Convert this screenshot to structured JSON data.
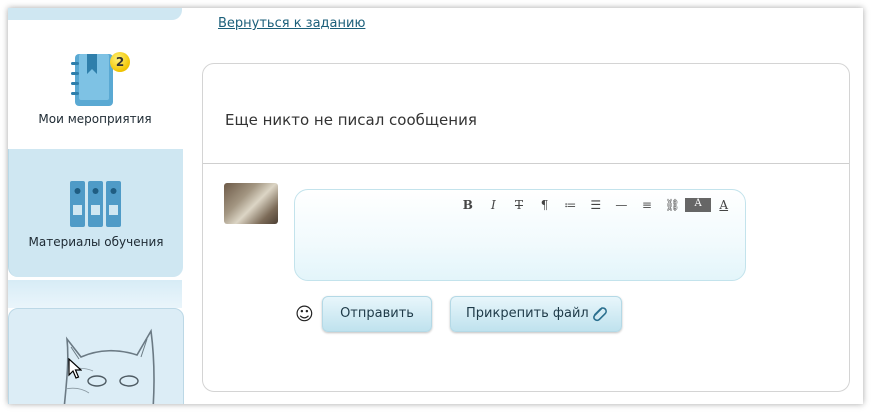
{
  "sidebar": {
    "items": [
      {
        "label": "Мои мероприятия",
        "icon": "bookmark-book-icon",
        "badge": "2",
        "active": true
      },
      {
        "label": "Материалы обучения",
        "icon": "binders-icon",
        "active": false
      }
    ],
    "tile_icon": "cat-sketch-image"
  },
  "content": {
    "back_link": "Вернуться к заданию",
    "empty_message": "Еще никто не писал сообщения",
    "toolbar": [
      "B",
      "I",
      "T",
      "¶",
      "≔",
      "☰",
      "—",
      "≡",
      "⛓",
      "A",
      "A"
    ],
    "send_label": "Отправить",
    "attach_label": "Прикрепить файл",
    "emoji_icon": "☺"
  },
  "colors": {
    "accent": "#1b5f7a",
    "sidebar_bg": "#cfe7f2",
    "button_bg": "#bfe2ee",
    "icon_blue": "#5aa9d3"
  }
}
